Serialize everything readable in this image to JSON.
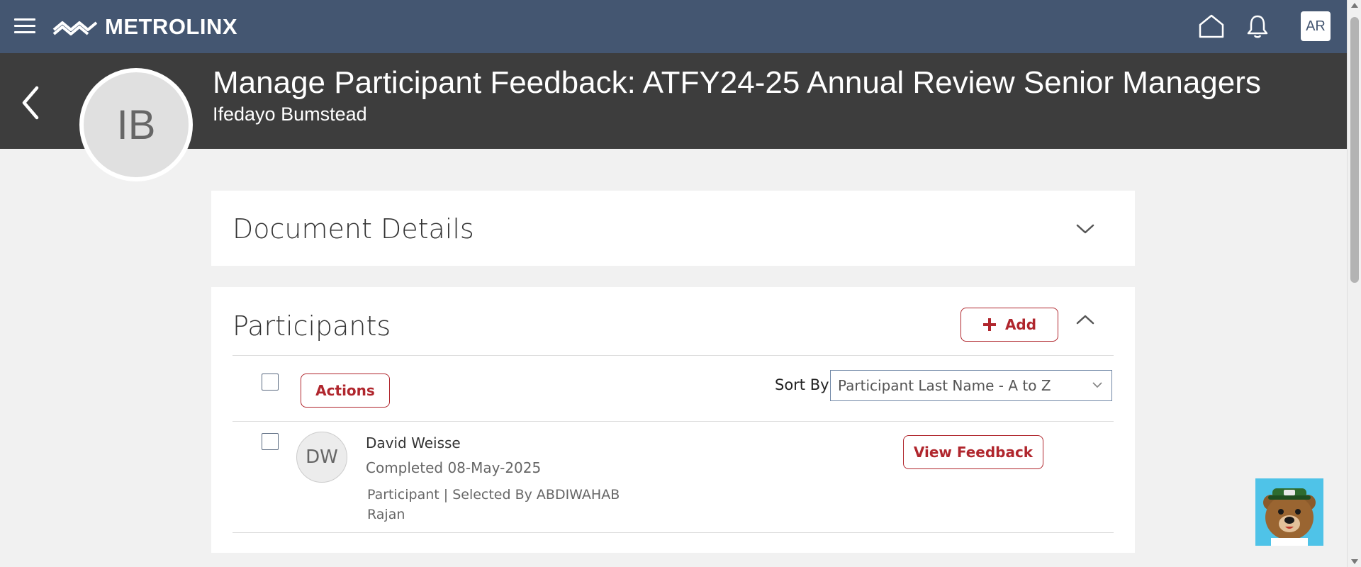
{
  "topbar": {
    "brand": "METROLINX",
    "user_initials": "AR",
    "colors": {
      "bar": "#445671",
      "accent": "#b0262d"
    },
    "icons": [
      "menu-icon",
      "home-icon",
      "bell-icon"
    ]
  },
  "header": {
    "title": "Manage Participant Feedback: ATFY24-25 Annual Review Senior Managers",
    "subtitle": "Ifedayo Bumstead",
    "avatar_initials": "IB"
  },
  "document_details": {
    "title": "Document Details",
    "expanded": false
  },
  "participants": {
    "title": "Participants",
    "expanded": true,
    "add_label": "Add",
    "actions_label": "Actions",
    "sort_label": "Sort By",
    "sort_value": "Participant Last Name - A to Z",
    "list": [
      {
        "initials": "DW",
        "name": "David Weisse",
        "status": "Completed 08-May-2025",
        "role_line1": "Participant | Selected By ABDIWAHAB",
        "role_line2": "Rajan",
        "action_label": "View Feedback",
        "checked": false
      }
    ]
  }
}
